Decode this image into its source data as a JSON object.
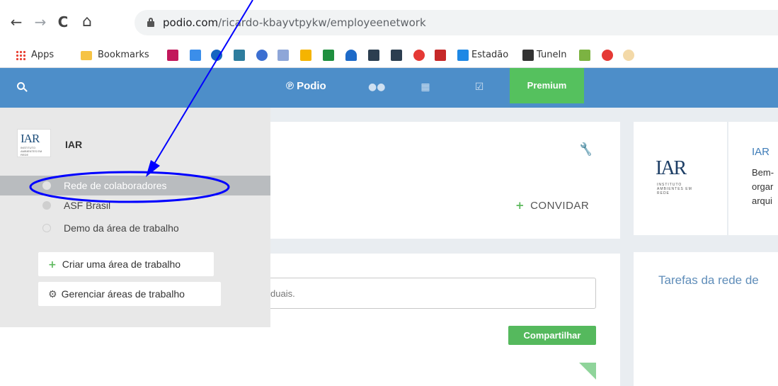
{
  "browser": {
    "url_host": "podio.com",
    "url_path": "/ricardo-kbayvtpykw/employeenetwork",
    "nav_icons": [
      "back-arrow-icon",
      "forward-arrow-icon",
      "reload-icon",
      "home-icon",
      "lock-icon"
    ],
    "nav_glyphs": {
      "back": "←",
      "forward": "→",
      "reload": "C",
      "home": "⌂"
    }
  },
  "bookmarks": {
    "apps_label": "Apps",
    "bookmarks_label": "Bookmarks",
    "estadao_label": "Estadão",
    "tunein_label": "TuneIn",
    "icon_colors": [
      "#c2185b",
      "#3b8eea",
      "#1565c0",
      "#2e7d9e",
      "#3c6fd1",
      "#f5b400",
      "#1f8f3f",
      "#1d6ac8",
      "#2c3e50",
      "#2c3e50",
      "#e53935",
      "#c62828"
    ]
  },
  "appbar": {
    "podio_label": "Podio",
    "podio_mark": "℗",
    "premium_label": "Premium",
    "colors": {
      "bar": "#4d8ec9",
      "premium": "#55c15e"
    }
  },
  "workspace_panel": {
    "org_logo_text": "IAR",
    "org_logo_sub": "INSTITUTO AMBIENTES EM REDE",
    "org_name": "IAR",
    "items": [
      {
        "label": "Rede de colaboradores",
        "active": true
      },
      {
        "label": "ASF Brasil",
        "active": false
      },
      {
        "label": "Demo da área de trabalho",
        "active": false
      }
    ],
    "create_label": "Criar uma área de trabalho",
    "manage_label": "Gerenciar áreas de trabalho"
  },
  "main": {
    "invite_label": "CONVIDAR",
    "status_placeholder_fragment": "duais.",
    "share_label": "Compartilhar"
  },
  "right": {
    "iar_logo_text": "IAR",
    "iar_logo_sub": "INSTITUTO AMBIENTES EM REDE",
    "iar_title": "IAR",
    "iar_lines": [
      "Bem-",
      "orgar",
      "arqui"
    ],
    "tasks_title": "Tarefas da rede de"
  },
  "annotation": {
    "color": "#0000ff"
  }
}
